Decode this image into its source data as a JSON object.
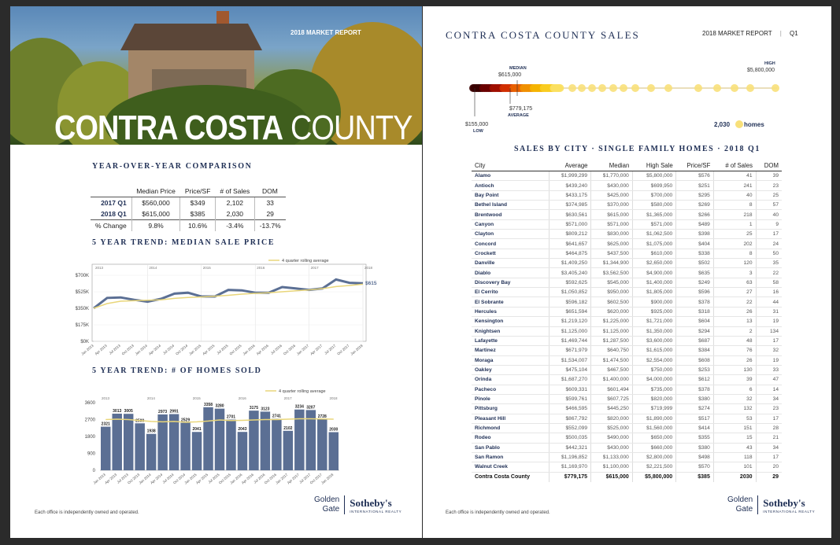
{
  "left": {
    "hero_report": "2018 MARKET REPORT",
    "hero_title_bold": "CONTRA COSTA",
    "hero_title_light": "COUNTY",
    "yoy_title": "YEAR-OVER-YEAR COMPARISON",
    "yoy": {
      "headers": [
        "",
        "Median Price",
        "Price/SF",
        "# of Sales",
        "DOM"
      ],
      "rows": [
        [
          "2017 Q1",
          "$560,000",
          "$349",
          "2,102",
          "33"
        ],
        [
          "2018 Q1",
          "$615,000",
          "$385",
          "2,030",
          "29"
        ],
        [
          "% Change",
          "9.8%",
          "10.6%",
          "-3.4%",
          "-13.7%"
        ]
      ]
    },
    "footer": "Each office is independently owned and operated."
  },
  "logo": {
    "golden1": "Golden",
    "golden2": "Gate",
    "sothebys": "Sotheby's",
    "intl": "INTERNATIONAL REALTY"
  },
  "chart_data": [
    {
      "type": "line",
      "title": "5 YEAR TREND: MEDIAN SALE PRICE",
      "legend": "4 quarter rolling average",
      "year_labels": [
        "2013",
        "2014",
        "2015",
        "2016",
        "2017",
        "2018"
      ],
      "y_ticks": [
        "$0K",
        "$175K",
        "$350K",
        "$525K",
        "$700K"
      ],
      "ylim": [
        0,
        700000
      ],
      "end_label": "$615,000",
      "categories": [
        "Jan 2013",
        "Apr 2013",
        "Jul 2013",
        "Oct 2013",
        "Jan 2014",
        "Apr 2014",
        "Jul 2014",
        "Oct 2014",
        "Jan 2015",
        "Apr 2015",
        "Jul 2015",
        "Oct 2015",
        "Jan 2016",
        "Apr 2016",
        "Jul 2016",
        "Oct 2016",
        "Jan 2017",
        "Apr 2017",
        "Jul 2017",
        "Oct 2017",
        "Jan 2018"
      ],
      "series": [
        {
          "values": [
            350000,
            460000,
            465000,
            440000,
            420000,
            450000,
            505000,
            515000,
            475000,
            475000,
            545000,
            540000,
            515000,
            515000,
            575000,
            560000,
            545000,
            560000,
            655000,
            620000,
            615000
          ],
          "color": "#5b6f94"
        },
        {
          "values": [
            350000,
            400000,
            425000,
            430000,
            435000,
            440000,
            455000,
            465000,
            470000,
            478000,
            488000,
            500000,
            508000,
            515000,
            525000,
            535000,
            545000,
            558000,
            580000,
            592000,
            605000
          ],
          "color": "#e9d67a"
        }
      ]
    },
    {
      "type": "bar",
      "title": "5 YEAR TREND: # OF HOMES SOLD",
      "legend": "4 quarter rolling average",
      "year_labels": [
        "2013",
        "2014",
        "2015",
        "2016",
        "2017",
        "2018"
      ],
      "y_ticks": [
        "0",
        "900",
        "1800",
        "2700",
        "3600"
      ],
      "ylim": [
        0,
        3600
      ],
      "categories": [
        "Jan 2013",
        "Apr 2013",
        "Jul 2013",
        "Oct 2013",
        "Jan 2014",
        "Apr 2014",
        "Jul 2014",
        "Oct 2014",
        "Jan 2015",
        "Apr 2015",
        "Jul 2015",
        "Oct 2015",
        "Jan 2016",
        "Apr 2016",
        "Jul 2016",
        "Oct 2016",
        "Jan 2017",
        "Apr 2017",
        "Jul 2017",
        "Oct 2017",
        "Jan 2018"
      ],
      "values": [
        2321,
        3013,
        3005,
        2500,
        1938,
        2973,
        2991,
        2529,
        2041,
        3358,
        3280,
        2701,
        2043,
        3175,
        3123,
        2741,
        2102,
        3234,
        3207,
        2728,
        2030
      ],
      "bar_color": "#5b6f94",
      "avg_values": [
        2700,
        2720,
        2700,
        2650,
        2600,
        2580,
        2600,
        2560,
        2580,
        2620,
        2680,
        2650,
        2660,
        2680,
        2700,
        2700,
        2720,
        2740,
        2740,
        2730,
        2720
      ],
      "avg_color": "#e9d67a"
    }
  ],
  "right": {
    "title": "CONTRA COSTA COUNTY SALES",
    "report": "2018 MARKET REPORT",
    "quarter": "Q1",
    "range": {
      "median_label": "MEDIAN",
      "median_value": "$615,000",
      "high_label": "HIGH",
      "high_value": "$5,800,000",
      "avg_value": "$779,175",
      "avg_label": "AVERAGE",
      "low_value": "$155,000",
      "low_label": "LOW",
      "homes_count": "2,030",
      "homes_label": "homes"
    },
    "city_title": "SALES BY CITY · SINGLE FAMILY HOMES · 2018 Q1",
    "city_headers": [
      "City",
      "Average",
      "Median",
      "High Sale",
      "Price/SF",
      "# of Sales",
      "DOM"
    ],
    "cities": [
      [
        "Alamo",
        "$1,999,299",
        "$1,770,000",
        "$5,800,000",
        "$576",
        "41",
        "39"
      ],
      [
        "Antioch",
        "$439,240",
        "$430,000",
        "$699,950",
        "$251",
        "241",
        "23"
      ],
      [
        "Bay Point",
        "$433,175",
        "$425,000",
        "$700,000",
        "$295",
        "40",
        "25"
      ],
      [
        "Bethel Island",
        "$374,985",
        "$370,000",
        "$580,000",
        "$269",
        "8",
        "57"
      ],
      [
        "Brentwood",
        "$630,561",
        "$615,000",
        "$1,365,000",
        "$266",
        "218",
        "40"
      ],
      [
        "Canyon",
        "$571,000",
        "$571,000",
        "$571,000",
        "$489",
        "1",
        "9"
      ],
      [
        "Clayton",
        "$809,212",
        "$830,000",
        "$1,062,500",
        "$398",
        "25",
        "17"
      ],
      [
        "Concord",
        "$641,657",
        "$625,000",
        "$1,075,000",
        "$404",
        "202",
        "24"
      ],
      [
        "Crockett",
        "$464,875",
        "$437,500",
        "$610,000",
        "$338",
        "8",
        "50"
      ],
      [
        "Danville",
        "$1,409,250",
        "$1,344,900",
        "$2,650,000",
        "$502",
        "120",
        "35"
      ],
      [
        "Diablo",
        "$3,405,240",
        "$3,562,500",
        "$4,900,000",
        "$635",
        "3",
        "22"
      ],
      [
        "Discovery Bay",
        "$592,625",
        "$545,000",
        "$1,400,000",
        "$249",
        "63",
        "58"
      ],
      [
        "El Cerrito",
        "$1,050,852",
        "$950,000",
        "$1,805,000",
        "$596",
        "27",
        "16"
      ],
      [
        "El Sobrante",
        "$596,182",
        "$602,500",
        "$900,000",
        "$378",
        "22",
        "44"
      ],
      [
        "Hercules",
        "$651,594",
        "$620,000",
        "$925,000",
        "$318",
        "26",
        "31"
      ],
      [
        "Kensington",
        "$1,219,120",
        "$1,225,000",
        "$1,721,000",
        "$604",
        "13",
        "19"
      ],
      [
        "Knightsen",
        "$1,125,000",
        "$1,125,000",
        "$1,350,000",
        "$294",
        "2",
        "134"
      ],
      [
        "Lafayette",
        "$1,469,744",
        "$1,287,500",
        "$3,600,000",
        "$687",
        "48",
        "17"
      ],
      [
        "Martinez",
        "$671,979",
        "$640,750",
        "$1,615,000",
        "$384",
        "76",
        "32"
      ],
      [
        "Moraga",
        "$1,534,007",
        "$1,474,500",
        "$2,554,000",
        "$608",
        "26",
        "19"
      ],
      [
        "Oakley",
        "$475,104",
        "$467,500",
        "$750,000",
        "$253",
        "130",
        "33"
      ],
      [
        "Orinda",
        "$1,687,270",
        "$1,400,000",
        "$4,000,000",
        "$612",
        "39",
        "47"
      ],
      [
        "Pacheco",
        "$609,331",
        "$601,494",
        "$735,000",
        "$378",
        "6",
        "14"
      ],
      [
        "Pinole",
        "$599,761",
        "$607,725",
        "$820,000",
        "$380",
        "32",
        "34"
      ],
      [
        "Pittsburg",
        "$466,595",
        "$445,250",
        "$719,999",
        "$274",
        "132",
        "23"
      ],
      [
        "Pleasant Hill",
        "$867,792",
        "$820,000",
        "$1,890,000",
        "$517",
        "53",
        "17"
      ],
      [
        "Richmond",
        "$552,099",
        "$525,000",
        "$1,560,000",
        "$414",
        "151",
        "28"
      ],
      [
        "Rodeo",
        "$500,035",
        "$490,000",
        "$650,000",
        "$355",
        "15",
        "21"
      ],
      [
        "San Pablo",
        "$442,321",
        "$430,000",
        "$660,000",
        "$380",
        "43",
        "34"
      ],
      [
        "San Ramon",
        "$1,196,852",
        "$1,133,000",
        "$2,800,000",
        "$498",
        "118",
        "17"
      ],
      [
        "Walnut Creek",
        "$1,169,970",
        "$1,100,000",
        "$2,221,500",
        "$570",
        "101",
        "20"
      ]
    ],
    "total": [
      "Contra Costa County",
      "$779,175",
      "$615,000",
      "$5,800,000",
      "$385",
      "2030",
      "29"
    ],
    "footer": "Each office is independently owned and operated."
  }
}
